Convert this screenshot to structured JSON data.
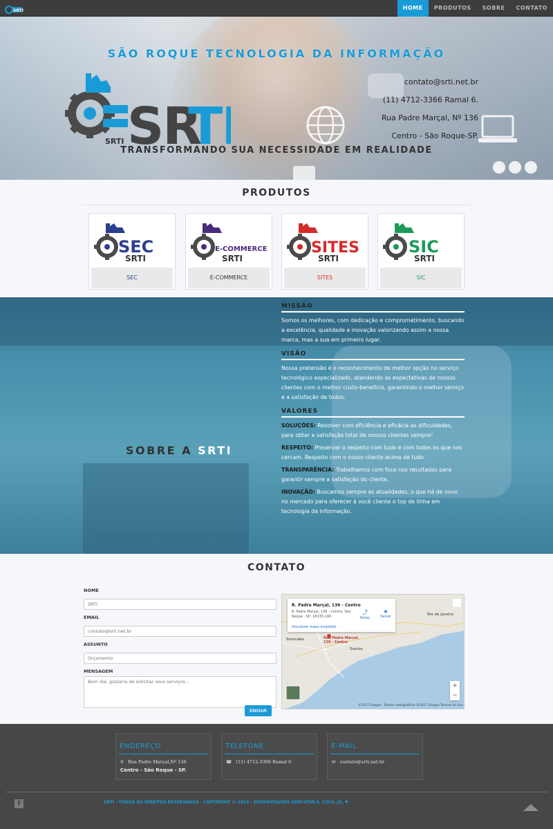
{
  "nav": {
    "items": [
      "HOME",
      "PRODUTOS",
      "SOBRE",
      "CONTATO"
    ],
    "active": "HOME"
  },
  "hero": {
    "title": "SÃO ROQUE TECNOLOGIA DA INFORMAÇÃO",
    "contact_lines": [
      "contato@srti.net.br",
      "(11) 4712-3366 Ramal 6.",
      "Rua Padre Marçal, Nº 136",
      "Centro - São Roque-SP."
    ],
    "slogan": "TRANSFORMANDO SUA NECESSIDADE EM REALIDADE",
    "logo_text": "SRTI"
  },
  "products": {
    "title": "PRODUTOS",
    "items": [
      {
        "name": "SEC",
        "logo_text": "SEC",
        "sub": "SRTI",
        "color": "#2c3e8f"
      },
      {
        "name": "E-COMMERCE",
        "logo_text": "E-COMMERCE",
        "sub": "SRTI",
        "color": "#4a2a7a"
      },
      {
        "name": "SITES",
        "logo_text": "SITES",
        "sub": "SRTI",
        "color": "#d62a2a"
      },
      {
        "name": "SIC",
        "logo_text": "SIC",
        "sub": "SRTI",
        "color": "#1c9a5a"
      }
    ]
  },
  "about": {
    "title_prefix": "SOBRE A ",
    "title_accent": "SRTI",
    "missao_title": "MISSÃO",
    "missao_text": "Somos os melhores, com dedicação e comprometimento, buscando a excelência, qualidade e inovação valorizando assim a nossa marca, mas a sua em primeiro lugar.",
    "visao_title": "VISÃO",
    "visao_text": "Nossa pretensão é o reconhecimento de melhor opção no serviço tecnológico especializado, atendendo as expectativas de nossos clientes com o melhor custo-benefício, garantindo o melhor serviço e a satisfação de todos.",
    "valores_title": "VALORES",
    "valores": [
      {
        "key": "SOLUÇÕES:",
        "text": " Resolver com eficiência e eficácia as dificuldades, para obter a satisfação total de nossos clientes sempre!"
      },
      {
        "key": "RESPEITO:",
        "text": " Preservar o respeito com tudo e com todos os que nos cercam. Respeito com o nosso cliente acima de tudo."
      },
      {
        "key": "TRANSPARÊNCIA:",
        "text": " Trabalhamos com foco nos resultados para garantir sempre a satisfação do cliente."
      },
      {
        "key": "INOVAÇÃO:",
        "text": " Buscamos sempre as atualidades, o que há de novo no mercado para oferecer à você cliente o top de linha em tecnologia da informação."
      }
    ]
  },
  "contact": {
    "title": "CONTATO",
    "name_label": "NOME",
    "name_placeholder": "SRTI",
    "email_label": "EMAIL",
    "email_placeholder": "contato@srti.net.br",
    "subject_label": "ASSUNTO",
    "subject_placeholder": "Orçamento",
    "message_label": "MENSAGEM",
    "message_placeholder": "Bom dia, gostaria de solicitar seus serviços...",
    "submit_label": "ENVIAR"
  },
  "map": {
    "card_title": "R. Padre Marçal, 136 - Centro",
    "card_addr": "R. Padre Marçal, 136 - Centro, São Roque - SP, 18130-100",
    "card_link": "Visualizar mapa ampliado",
    "route_label": "Rotas",
    "save_label": "Salvar",
    "pin_label_1": "Rua Padre Marçal,",
    "pin_label_2": "136 - Centro",
    "cities": [
      "Rio de Janeiro",
      "Sorocaba",
      "Santos"
    ],
    "footer": "©2017 Google - Dados cartográficos ©2017 Google    Termos de Uso"
  },
  "footer": {
    "address_title": "ENDEREÇO",
    "address_line1": "Rua Padre Marçal,Nº 136",
    "address_line2": "Centro - São Roque - SP.",
    "phone_title": "TELEFONE",
    "phone_line": "(11) 4712-3366 Ramal 6",
    "email_title": "E-MAIL",
    "email_line": "contato@srti.net.br",
    "copyright": "SRTI - TODOS OS DIREITOS RESERVADOS - COPYRIGHT © 2016 - DESENVOLVIDO COM HTML5, CSS3, JS, ♥"
  },
  "colors": {
    "accent": "#1a9bd7",
    "navbar": "#3d3d3d",
    "footer": "#474747",
    "about_bg": "#4a92ae"
  }
}
